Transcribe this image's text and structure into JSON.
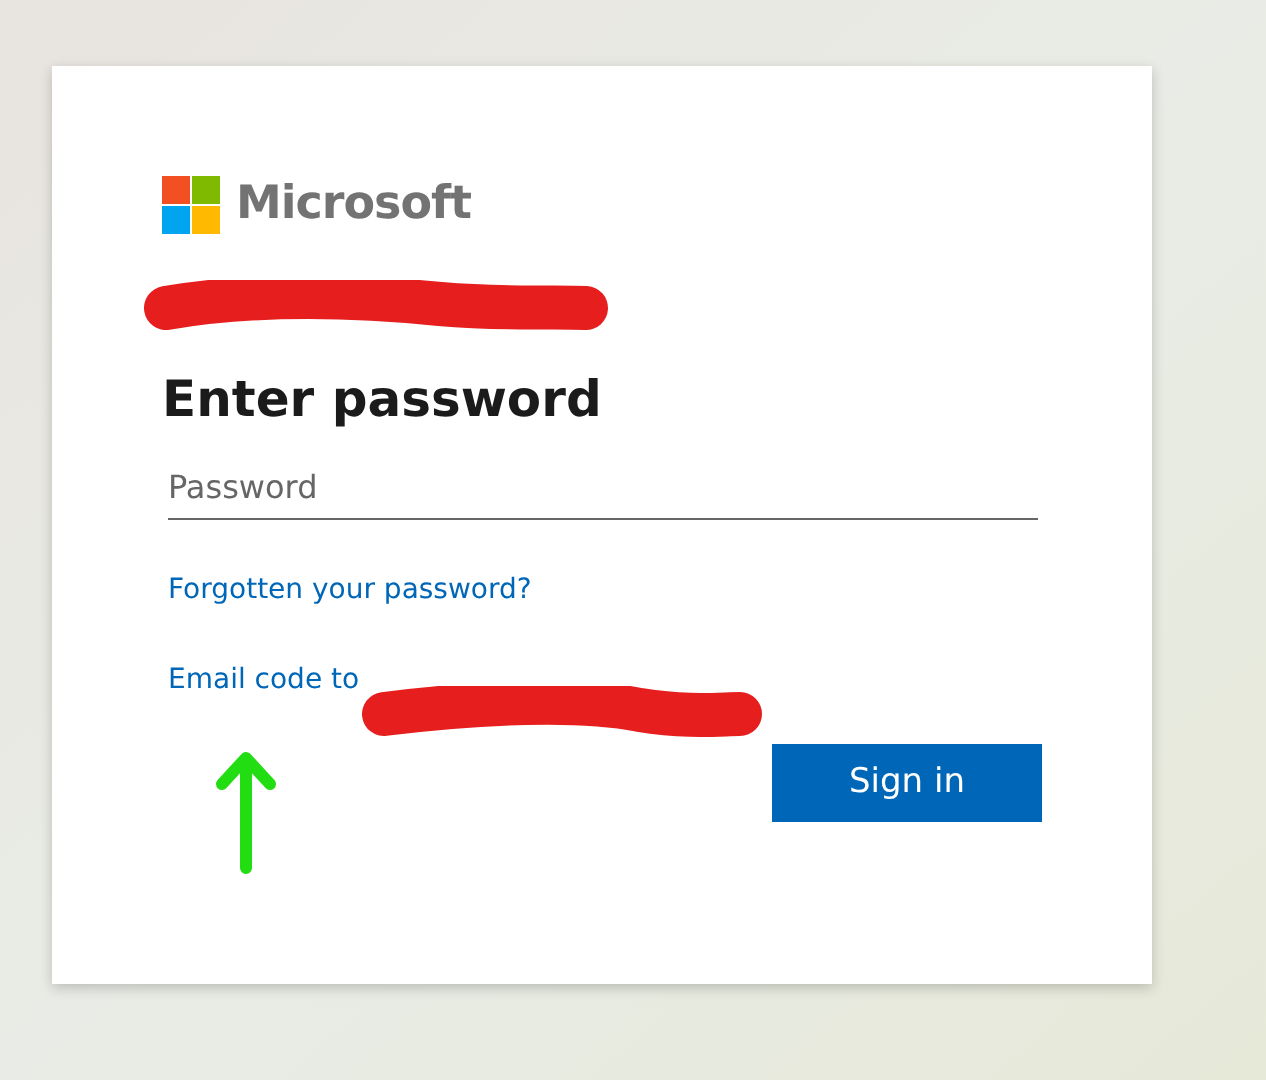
{
  "logo": {
    "text": "Microsoft"
  },
  "heading": "Enter password",
  "password_field": {
    "placeholder": "Password"
  },
  "links": [
    "Forgotten your password?",
    "Email code to"
  ],
  "buttons": [
    "Sign in"
  ]
}
